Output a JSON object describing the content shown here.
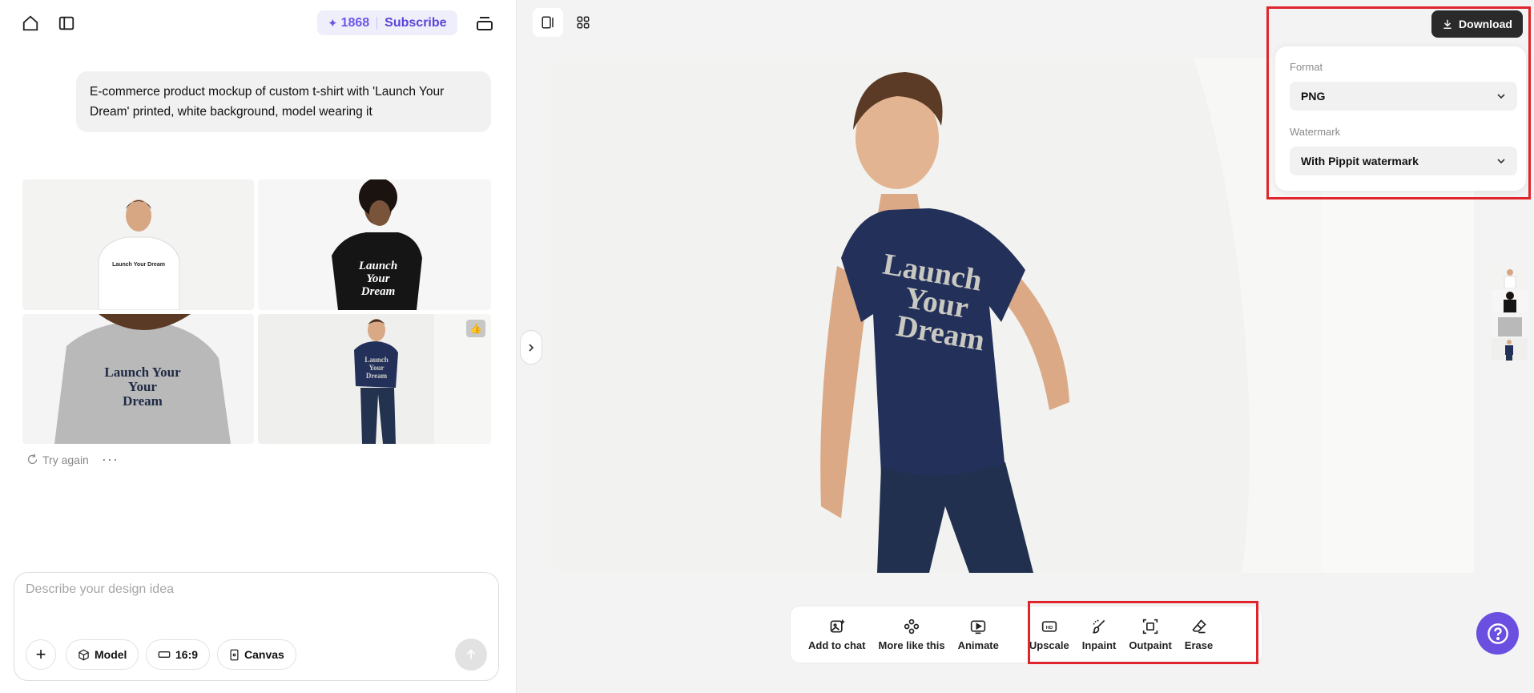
{
  "header": {
    "home_icon": "home-icon",
    "sidebar_icon": "sidebar-toggle-icon",
    "credits": "1868",
    "subscribe_label": "Subscribe",
    "menu_icon": "stack-menu-icon"
  },
  "chat": {
    "prompt": "E-commerce product mockup of custom t-shirt with 'Launch Your Dream' printed, white background, model wearing it",
    "results": [
      {
        "shirt_color": "#ffffff",
        "print_text": "Launch Your Dream"
      },
      {
        "shirt_color": "#151515",
        "print_text": "Launch Your Dream"
      },
      {
        "shirt_color": "#b9b9b9",
        "print_text": "Launch Your Dream"
      },
      {
        "shirt_color": "#23305a",
        "print_text": "Launch Your Dream"
      }
    ],
    "like_icon": "thumbs-up-icon",
    "try_again_label": "Try again",
    "more_label": "···"
  },
  "composer": {
    "placeholder": "Describe your design idea",
    "model_label": "Model",
    "ratio_label": "16:9",
    "canvas_label": "Canvas"
  },
  "main_image": {
    "print_lines": [
      "Launch",
      "Your",
      "Dream"
    ]
  },
  "download": {
    "button_label": "Download",
    "format_label": "Format",
    "format_value": "PNG",
    "watermark_label": "Watermark",
    "watermark_value": "With Pippit watermark"
  },
  "toolbar": {
    "items": [
      {
        "label": "Add to chat",
        "icon": "add-image-icon"
      },
      {
        "label": "More like this",
        "icon": "dots-cluster-icon"
      },
      {
        "label": "Animate",
        "icon": "animate-icon"
      },
      {
        "label": "Upscale",
        "icon": "hd-icon"
      },
      {
        "label": "Inpaint",
        "icon": "brush-icon"
      },
      {
        "label": "Outpaint",
        "icon": "expand-icon"
      },
      {
        "label": "Erase",
        "icon": "eraser-icon"
      }
    ]
  },
  "colors": {
    "accent": "#6b58e6",
    "highlight": "#e0242b",
    "help": "#6a4fe0"
  }
}
